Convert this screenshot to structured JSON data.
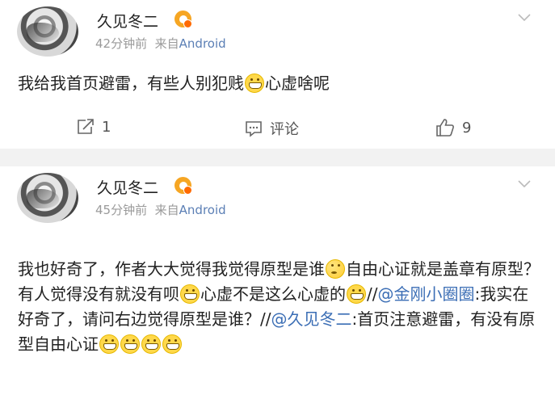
{
  "post1": {
    "author": "久见冬二",
    "time": "42分钟前",
    "source_prefix": "来自",
    "source": "Android",
    "text_a": "我给我首页避雷，有些人别犯贱",
    "text_b": "心虚啥呢",
    "shares": "1",
    "comment_label": "评论",
    "likes": "9"
  },
  "post2": {
    "author": "久见冬二",
    "time": "45分钟前",
    "source_prefix": "来自",
    "source": "Android",
    "seg1": "我也好奇了，作者大大觉得我觉得原型是谁",
    "seg2": "自由心证就是盖章有原型？有人觉得没有就没有呗",
    "seg3": "心虚不是这么心虚的",
    "seg4": "//",
    "mention1": "@金刚小圈圈",
    "seg5": ":我实在好奇了，请问右边觉得原型是谁？//",
    "mention2": "@久见冬二",
    "seg6": ":首页注意避雷，有没有原型自由心证"
  },
  "icons": {
    "verified": "verified-badge-icon",
    "chevron": "chevron-down-icon",
    "share": "share-icon",
    "comment": "comment-icon",
    "like": "thumbs-up-icon",
    "grin_emoji": "grin-emoji-icon",
    "thinking_emoji": "thinking-emoji-icon"
  },
  "colors": {
    "link": "#3b6eb5",
    "source": "#5b7fb5",
    "badge": "#f6a623",
    "muted": "#9a9a9a"
  }
}
